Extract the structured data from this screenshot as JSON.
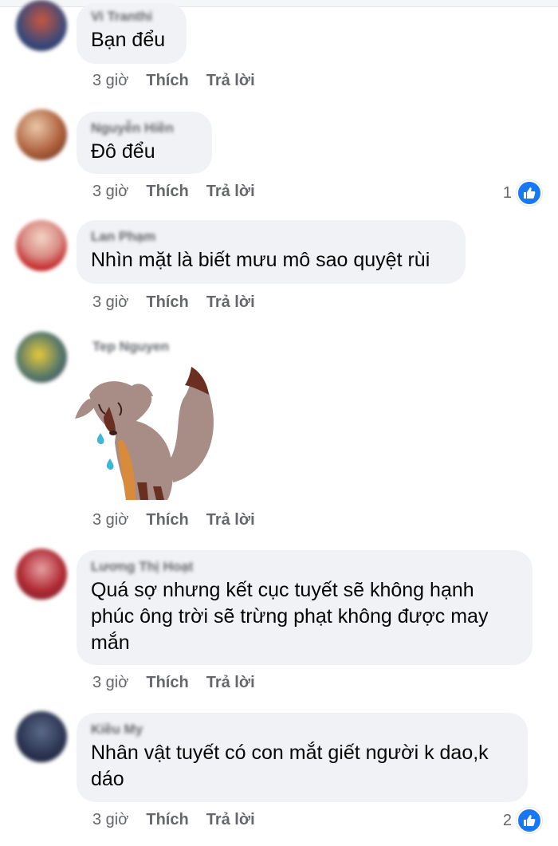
{
  "comments": [
    {
      "author": "Vi Tranthi",
      "text": "Bạn đểu",
      "time": "3 giờ",
      "like": "Thích",
      "reply": "Trả lời",
      "reactions": ""
    },
    {
      "author": "Nguyễn Hiền",
      "text": "Đô đểu",
      "time": "3 giờ",
      "like": "Thích",
      "reply": "Trả lời",
      "reactions": "1"
    },
    {
      "author": "Lan Phạm",
      "text": "Nhìn mặt là biết mưu mô sao quyệt rùi",
      "time": "3 giờ",
      "like": "Thích",
      "reply": "Trả lời",
      "reactions": ""
    },
    {
      "author": "Tep Nguyen",
      "text": "",
      "time": "3 giờ",
      "like": "Thích",
      "reply": "Trả lời",
      "reactions": "",
      "sticker": "crying-fox-sticker"
    },
    {
      "author": "Lương Thị Hoạt",
      "text": "Quá sợ  nhưng kết cục tuyết sẽ không hạnh phúc ông trời sẽ trừng phạt  không được may mắn",
      "time": "3 giờ",
      "like": "Thích",
      "reply": "Trả lời",
      "reactions": ""
    },
    {
      "author": "Kiều My",
      "text": "Nhân vật tuyết có con mắt giết người k dao,k dáo",
      "time": "3 giờ",
      "like": "Thích",
      "reply": "Trả lời",
      "reactions": "2"
    }
  ],
  "colors": {
    "bubble": "#f0f2f5",
    "like_blue": "#1877f2",
    "meta_gray": "#65676b"
  },
  "icons": {
    "reaction": "like-thumbs-up-icon"
  }
}
